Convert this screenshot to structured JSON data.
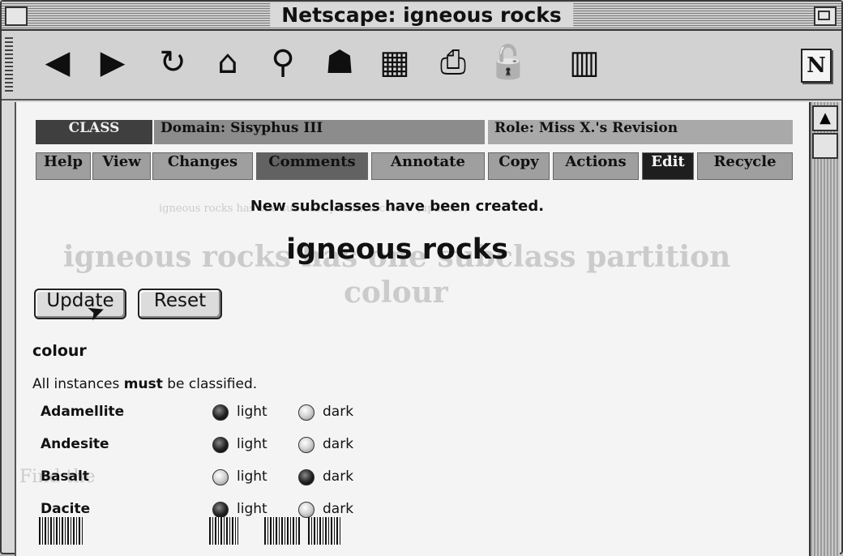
{
  "window": {
    "title": "Netscape: igneous rocks"
  },
  "toolbar": {
    "icons": [
      "back-icon",
      "forward-icon",
      "reload-icon",
      "home-icon",
      "search-icon",
      "guide-icon",
      "images-icon",
      "print-icon",
      "security-icon",
      "stop-icon"
    ],
    "logo": "N"
  },
  "header": {
    "kind": "CLASS",
    "domain": "Domain: Sisyphus III",
    "role": "Role: Miss X.'s Revision"
  },
  "nav": {
    "help": "Help",
    "view": "View",
    "changes": "Changes",
    "comments": "Comments",
    "annotate": "Annotate",
    "copy": "Copy",
    "actions": "Actions",
    "edit": "Edit",
    "recycle": "Recycle"
  },
  "main": {
    "message": "New subclasses have been created.",
    "title": "igneous rocks",
    "update_label": "Update",
    "reset_label": "Reset",
    "section_label": "colour",
    "instruction_prefix": "All instances ",
    "instruction_bold": "must",
    "instruction_suffix": " be classified.",
    "rows": [
      {
        "name": "Adamellite",
        "light": "light",
        "dark": "dark",
        "selected": "light"
      },
      {
        "name": "Andesite",
        "light": "light",
        "dark": "dark",
        "selected": "light"
      },
      {
        "name": "Basalt",
        "light": "light",
        "dark": "dark",
        "selected": "dark"
      },
      {
        "name": "Dacite",
        "light": "light",
        "dark": "dark",
        "selected": "light"
      }
    ]
  },
  "ghost_text": {
    "line1": "igneous rocks has one subclass partition",
    "line2": "colour",
    "line3": "igneous rocks has one subclass partition colour (updated)",
    "line4": "Find the"
  }
}
